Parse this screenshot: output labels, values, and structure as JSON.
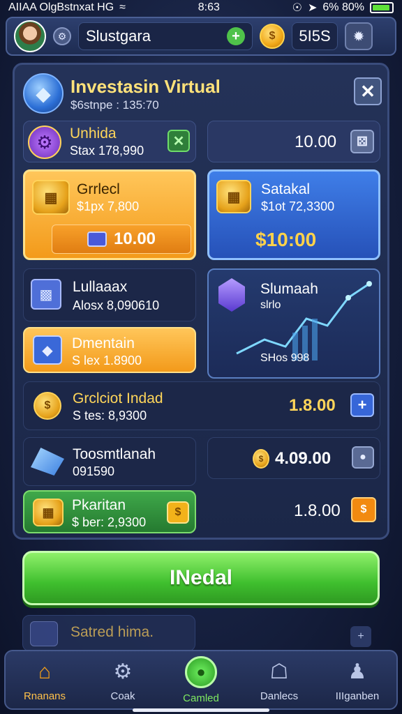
{
  "status_bar": {
    "left_text": "AIIAA OlgBstnxat HG",
    "time": "8:63",
    "battery_text": "6% 80%"
  },
  "top_bar": {
    "player_name": "Slustgara",
    "currency_value": "5I5S"
  },
  "panel": {
    "title": "Investasin Virtual",
    "subtitle": "$6stnpe : 135:70"
  },
  "items": [
    {
      "title": "Unhida",
      "sub": "Stax 178,990"
    },
    {
      "value": "10.00"
    },
    {
      "title": "Grrlecl",
      "sub": "$1px 7,800",
      "buy": "10.00"
    },
    {
      "title": "Satakal",
      "sub": "$1ot 72,3300",
      "price": "$10:00"
    },
    {
      "title": "Lullaaax",
      "sub": "Alosx 8,090610"
    },
    {
      "title": "Slumaah",
      "sub": "slrlo",
      "footer": "SHos 998"
    },
    {
      "title": "Dmentain",
      "sub": "S lex 1.8900"
    },
    {
      "title": "Grclciot Indad",
      "sub": "S tes: 8,9300",
      "value": "1.8.00"
    },
    {
      "title": "Toosmtlanah",
      "sub": "091590",
      "value": "4.09.00"
    },
    {
      "title": "Pkaritan",
      "sub": "$ ber: 2,9300",
      "value": "1.8.00"
    }
  ],
  "main_button": "INedal",
  "faded_item": {
    "title": "Satred hima."
  },
  "nav": [
    {
      "label": "Rnanans",
      "icon": "home-icon"
    },
    {
      "label": "Coak",
      "icon": "gear-icon"
    },
    {
      "label": "Camled",
      "icon": "game-icon"
    },
    {
      "label": "Danlecs",
      "icon": "shop-icon"
    },
    {
      "label": "IIIganben",
      "icon": "profile-icon"
    }
  ]
}
